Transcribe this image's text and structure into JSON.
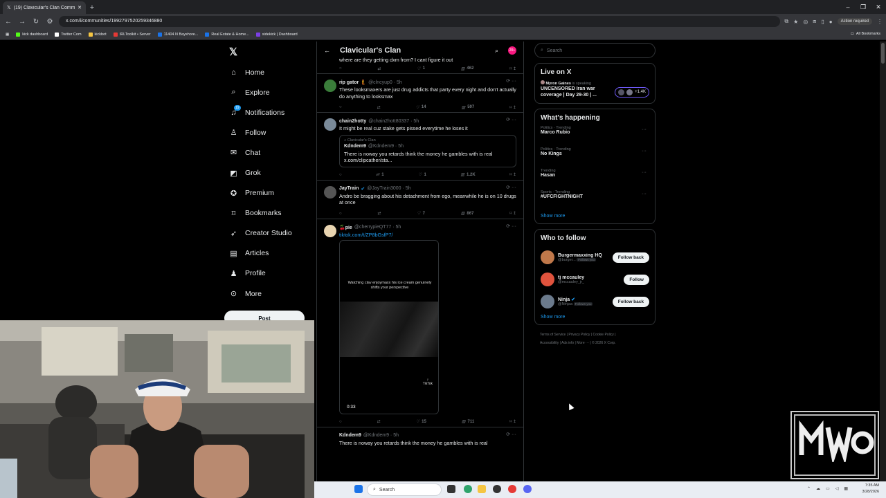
{
  "browser": {
    "tab_title": "(19) Clavicular's Clan Commun",
    "url": "x.com/i/communities/1992797520259346880",
    "action_required": "Action required",
    "bookmarks": [
      {
        "label": "kick dashboard",
        "color": "#53fc18"
      },
      {
        "label": "Twitter Com",
        "color": "#ffffff"
      },
      {
        "label": "kickbot",
        "color": "#f5c542"
      },
      {
        "label": "IRLToolkit • Server",
        "color": "#e53935"
      },
      {
        "label": "11404 N Bayshore...",
        "color": "#1a73e8"
      },
      {
        "label": "Real Estate & Home...",
        "color": "#1a73e8"
      },
      {
        "label": "sidekick | Dashboard",
        "color": "#7b3fe4"
      }
    ],
    "all_bookmarks": "All Bookmarks"
  },
  "nav": {
    "items": [
      {
        "label": "Home",
        "icon": "⌂"
      },
      {
        "label": "Explore",
        "icon": "⌕"
      },
      {
        "label": "Notifications",
        "icon": "🔔",
        "badge": "19"
      },
      {
        "label": "Follow",
        "icon": "👤"
      },
      {
        "label": "Chat",
        "icon": "✉"
      },
      {
        "label": "Grok",
        "icon": "◩"
      },
      {
        "label": "Premium",
        "icon": "✪"
      },
      {
        "label": "Bookmarks",
        "icon": "🔖"
      },
      {
        "label": "Creator Studio",
        "icon": "🚀"
      },
      {
        "label": "Articles",
        "icon": "▤"
      },
      {
        "label": "Profile",
        "icon": "👤"
      },
      {
        "label": "More",
        "icon": "⊙"
      }
    ],
    "post_label": "Post"
  },
  "community": {
    "title": "Clavicular's Clan",
    "badge": "20+",
    "top_snippet": "where are they getting dxm from? I cant figure it out",
    "top_actions": {
      "likes": "1",
      "views": "462"
    },
    "tweets": [
      {
        "name": "rip gator 🧜",
        "handle": "@clncyup0 · 5h",
        "text": "These looksmaxers are just drug addicts that party every night and don't actually do anything to looksmax",
        "likes": "14",
        "views": "597",
        "avatar": "#3a7d3a"
      },
      {
        "name": "chain2hotty",
        "handle": "@chain2hott80337 · 5h",
        "text": "It might be real cuz stake gets pissed everytime he loses it",
        "quote": {
          "community": "Clavicular's Clan",
          "name": "Kdndem9",
          "handle": "@Kdndem9 · 5h",
          "text": "There is noway you retards think the money he gambles with is real x.com/clipcather/sta..."
        },
        "reposts": "1",
        "likes": "1",
        "views": "1.2K",
        "avatar": "#7a8a99"
      },
      {
        "name": "JayTrain",
        "handle": "@JayTrain3000 · 5h",
        "text": "Andro be bragging about his detachment from ego, meanwhile he is on 10 drugs at once",
        "likes": "7",
        "views": "867",
        "avatar": "#555555"
      },
      {
        "name": "🍒pie",
        "handle": "@cherrypieQT77 · 5h",
        "link": "tiktok.com/t/ZP8bGsfP7/",
        "media_caption": "Watching clav enjoymaxx his ice cream genuinely shifts your perspective",
        "media_duration": "0:33",
        "tiktok_label": "TikTok",
        "likes": "15",
        "views": "711",
        "avatar": "#e8d4b0"
      },
      {
        "name": "Kdndem9",
        "handle": "@Kdndem9 · 5h",
        "text": "There is noway you retards think the money he gambles with is real",
        "avatar": "#444444"
      }
    ]
  },
  "sidebar": {
    "search_placeholder": "Search",
    "live": {
      "title": "Live on X",
      "host": "Myron Gaines",
      "status": "is speaking",
      "text": "UNCENSORED Iran war coverage | Day 29-30 | ...",
      "count": "+1.4K"
    },
    "happening": {
      "title": "What's happening",
      "trends": [
        {
          "context": "Politics · Trending",
          "name": "Marco Rubio"
        },
        {
          "context": "Politics · Trending",
          "name": "No Kings"
        },
        {
          "context": "Trending",
          "name": "Hasan"
        },
        {
          "context": "Sports · Trending",
          "name": "#UFCFIGHTNIGHT"
        }
      ],
      "show_more": "Show more"
    },
    "who_to_follow": {
      "title": "Who to follow",
      "accounts": [
        {
          "name": "Burgermaxxing HQ",
          "handle": "@burger...",
          "follows_you": "Follows you",
          "button": "Follow back",
          "avatar": "#c0784a"
        },
        {
          "name": "tj mccauley",
          "handle": "@mccauley_jr_",
          "follows_you": "",
          "button": "Follow",
          "avatar": "#e0533d"
        },
        {
          "name": "Ninja",
          "handle": "@Ninjaa",
          "follows_you": "Follows you",
          "button": "Follow back",
          "avatar": "#6b7a8c"
        }
      ],
      "show_more": "Show more"
    },
    "footer": [
      "Terms of Service",
      "Privacy Policy",
      "Cookie Policy",
      "Accessibility",
      "Ads info",
      "More ···",
      "© 2026 X Corp."
    ]
  },
  "taskbar": {
    "search": "Search",
    "time": "7:35 AM",
    "date": "3/28/2026"
  },
  "overlay_logo": {
    "text": "mWo",
    "subtitle": "mog world Order"
  }
}
